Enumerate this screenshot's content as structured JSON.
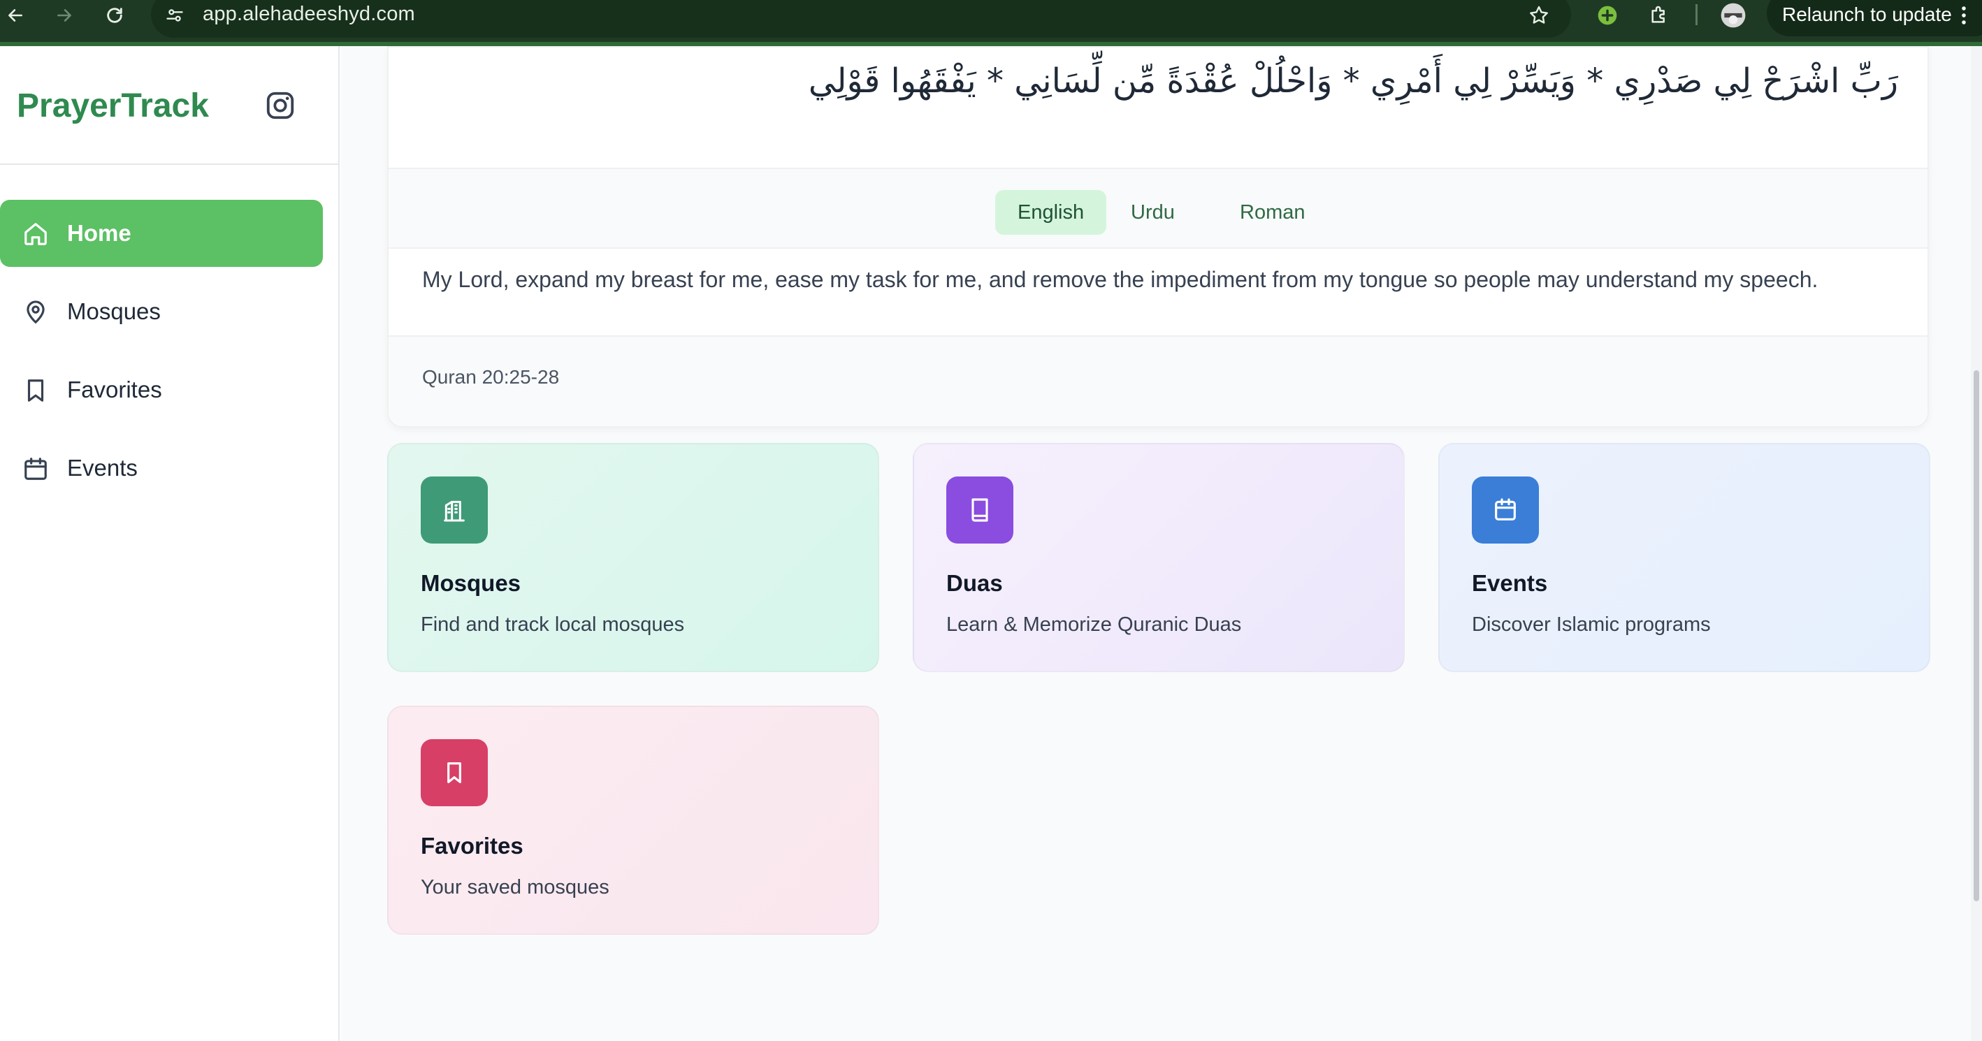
{
  "browser": {
    "url": "app.alehadeeshyd.com",
    "relaunch_label": "Relaunch to update",
    "icons": [
      "back-arrow-icon",
      "forward-arrow-icon",
      "reload-icon",
      "site-settings-icon",
      "star-icon",
      "extension-plus-icon",
      "puzzle-icon",
      "profile-avatar",
      "menu-dots-icon"
    ]
  },
  "sidebar": {
    "brand": "PrayerTrack",
    "items": [
      {
        "label": "Home",
        "icon": "home-icon",
        "active": true
      },
      {
        "label": "Mosques",
        "icon": "map-pin-icon",
        "active": false
      },
      {
        "label": "Favorites",
        "icon": "bookmark-icon",
        "active": false
      },
      {
        "label": "Events",
        "icon": "calendar-icon",
        "active": false
      }
    ]
  },
  "dua": {
    "arabic": "رَبِّ اشْرَحْ لِي صَدْرِي * وَيَسِّرْ لِي أَمْرِي * وَاحْلُلْ عُقْدَةً مِّن لِّسَانِي * يَفْقَهُوا قَوْلِي",
    "tabs": [
      "English",
      "Urdu",
      "Roman"
    ],
    "active_tab": "English",
    "translation": "My Lord, expand my breast for me, ease my task for me, and remove the impediment from my tongue so people may understand my speech.",
    "source": "Quran 20:25-28"
  },
  "features": [
    {
      "title": "Mosques",
      "desc": "Find and track local mosques",
      "icon": "building-icon",
      "color": "#3f9a78"
    },
    {
      "title": "Duas",
      "desc": "Learn & Memorize Quranic Duas",
      "icon": "book-icon",
      "color": "#8b4ce0"
    },
    {
      "title": "Events",
      "desc": "Discover Islamic programs",
      "icon": "calendar-icon",
      "color": "#3a7ed8"
    },
    {
      "title": "Favorites",
      "desc": "Your saved mosques",
      "icon": "bookmark-icon",
      "color": "#d83f66"
    }
  ],
  "colors": {
    "brand_green": "#2f8a4f",
    "active_nav": "#5cc064",
    "chrome_bg": "#1f3a24"
  }
}
